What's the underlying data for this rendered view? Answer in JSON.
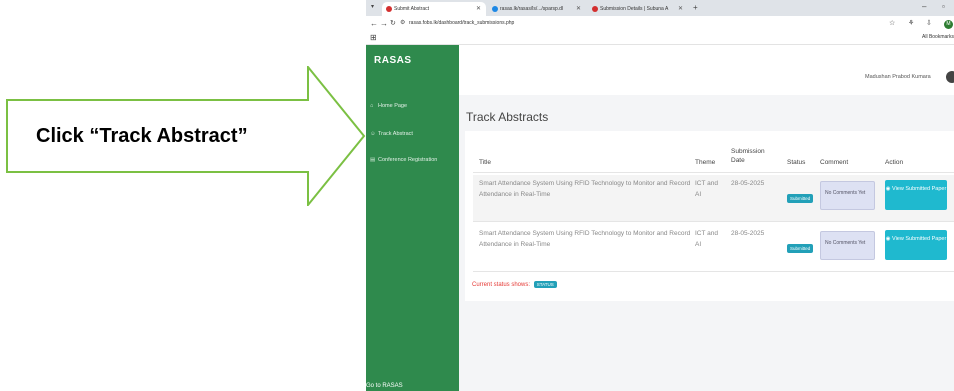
{
  "callout": {
    "text": "Click “Track Abstract”"
  },
  "browser": {
    "tabs": [
      {
        "label": "Submit Abstract"
      },
      {
        "label": "rasas.lk/rasas/ls/.../sparsp.dl"
      },
      {
        "label": "Submission Details | Subuna A"
      }
    ],
    "url": "rasas.fobs.lk/dashboard/track_submissions.php",
    "bookmarks_label": "All Bookmarks",
    "profile_initial": "M"
  },
  "sidebar": {
    "brand": "RASAS",
    "items": [
      {
        "label": "Home Page"
      },
      {
        "label": "Track Abstract"
      },
      {
        "label": "Conference Registration"
      }
    ],
    "goto": "Go to RASAS"
  },
  "header": {
    "user_name": "Madushan Prabod Kumara"
  },
  "main": {
    "title": "Track Abstracts",
    "table": {
      "columns": [
        "Title",
        "Theme",
        "Submission Date",
        "Status",
        "Comment",
        "Action"
      ],
      "rows": [
        {
          "title": "Smart Attendance System Using RFID Technology to Monitor and Record Attendance in Real-Time",
          "theme": "ICT and AI",
          "date": "28-05-2025",
          "status": "Submitted",
          "comment": "No Comments Yet",
          "action": "View Submitted Paper"
        },
        {
          "title": "Smart Attendance System Using RFID Technology to Monitor and Record Attendance in Real-Time",
          "theme": "ICT and AI",
          "date": "28-05-2025",
          "status": "Submitted",
          "comment": "No Comments Yet",
          "action": "View Submitted Paper"
        }
      ]
    },
    "status_note": "Current status shows:",
    "status_badge": "STATUS"
  },
  "colors": {
    "sidebar": "#2f8a4d",
    "accent_teal": "#1fb9cf",
    "badge": "#22a0b8",
    "callout_fill": "#ffffff",
    "callout_border": "#7bc043",
    "status_note": "#e53935"
  }
}
